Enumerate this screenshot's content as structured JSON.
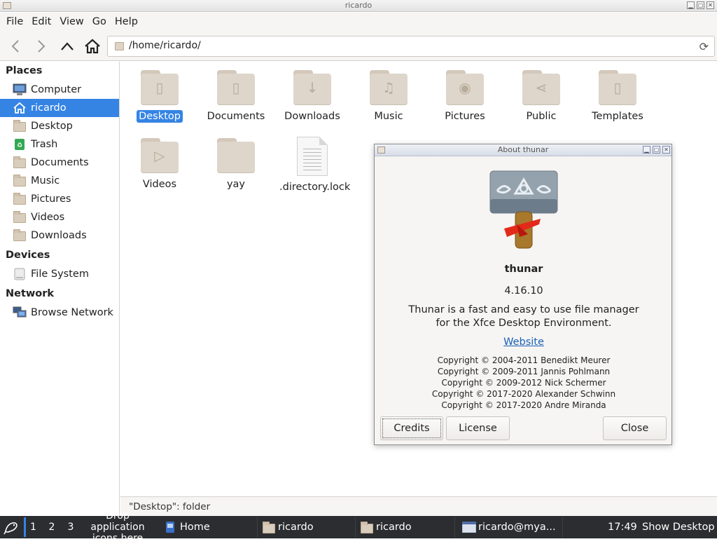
{
  "window": {
    "title": "ricardo"
  },
  "menubar": {
    "items": [
      "File",
      "Edit",
      "View",
      "Go",
      "Help"
    ]
  },
  "toolbar": {
    "path": "/home/ricardo/"
  },
  "sidebar": {
    "places_heading": "Places",
    "places": [
      "Computer",
      "ricardo",
      "Desktop",
      "Trash",
      "Documents",
      "Music",
      "Pictures",
      "Videos",
      "Downloads"
    ],
    "devices_heading": "Devices",
    "devices": [
      "File System"
    ],
    "network_heading": "Network",
    "network": [
      "Browse Network"
    ],
    "selected": "ricardo"
  },
  "files": [
    {
      "name": "Desktop",
      "glyph": "▯"
    },
    {
      "name": "Documents",
      "glyph": "▯"
    },
    {
      "name": "Downloads",
      "glyph": "↓"
    },
    {
      "name": "Music",
      "glyph": "♫"
    },
    {
      "name": "Pictures",
      "glyph": "◉"
    },
    {
      "name": "Public",
      "glyph": "⋖"
    },
    {
      "name": "Templates",
      "glyph": "▯"
    },
    {
      "name": "Videos",
      "glyph": "▷"
    },
    {
      "name": "yay",
      "glyph": ""
    },
    {
      "name": ".directory.lock",
      "glyph": ""
    }
  ],
  "statusbar": {
    "text": "\"Desktop\": folder"
  },
  "about": {
    "title": "About thunar",
    "app_name": "thunar",
    "version": "4.16.10",
    "description_line1": "Thunar is a fast and easy to use file manager",
    "description_line2": "for the Xfce Desktop Environment.",
    "website": "Website",
    "copyrights": [
      "Copyright © 2004-2011 Benedikt Meurer",
      "Copyright © 2009-2011 Jannis Pohlmann",
      "Copyright © 2009-2012 Nick Schermer",
      "Copyright © 2017-2020 Alexander Schwinn",
      "Copyright © 2017-2020 Andre Miranda"
    ],
    "buttons": {
      "credits": "Credits",
      "license": "License",
      "close": "Close"
    }
  },
  "taskbar": {
    "workspaces": [
      "1",
      "2",
      "3"
    ],
    "launcher_text_1": "Drop application",
    "launcher_text_2": "icons here",
    "tasks": [
      "Home",
      "ricardo",
      "ricardo",
      "ricardo@mya..."
    ],
    "clock": "17:49",
    "show_desktop": "Show Desktop"
  },
  "colors": {
    "selection": "#3584e4",
    "panel": "#2b2d30",
    "link": "#1a5fb4"
  }
}
